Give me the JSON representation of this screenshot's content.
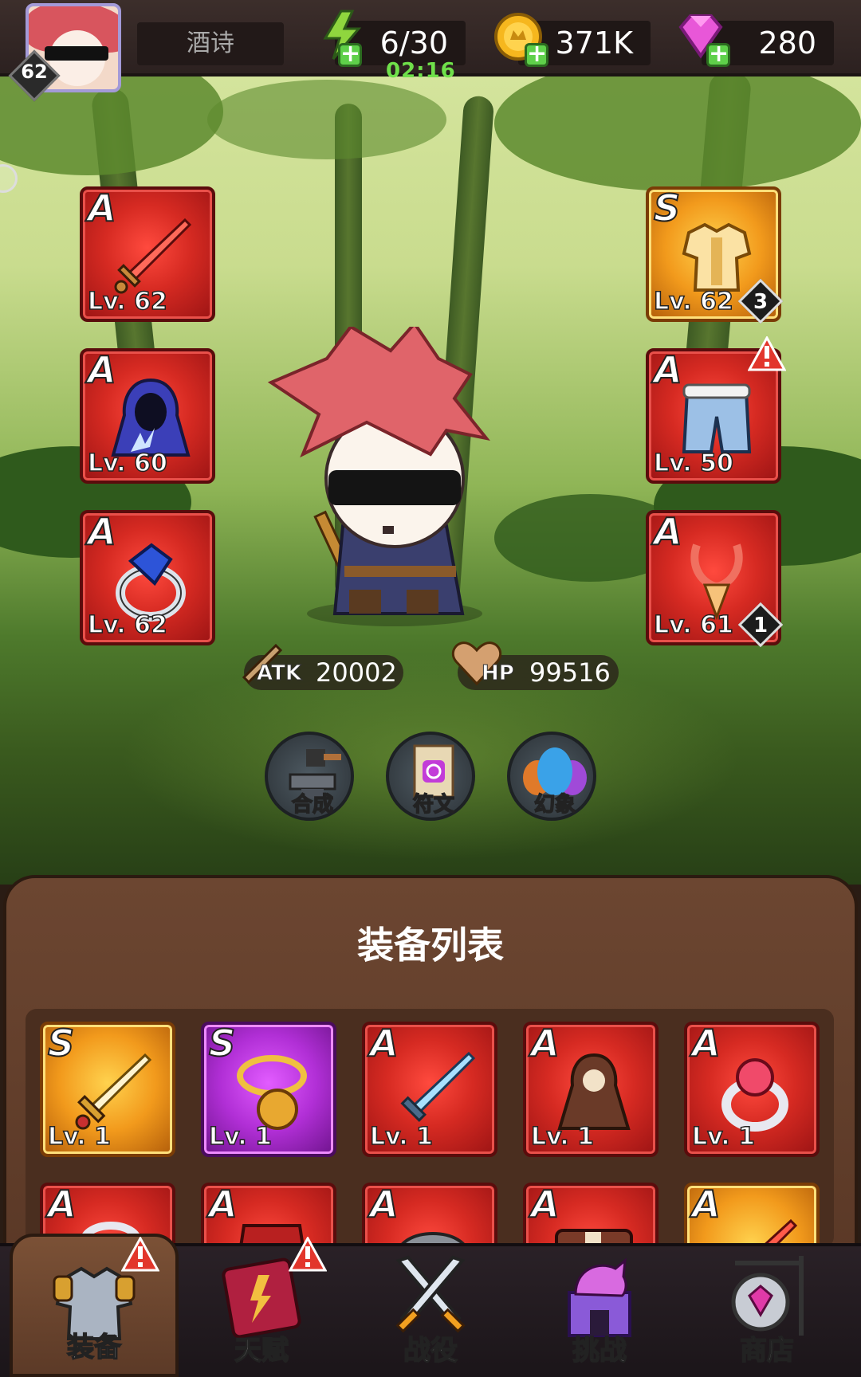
{
  "topbar": {
    "player_level": "62",
    "player_name": "酒诗",
    "energy": "6/30",
    "energy_timer": "02:16",
    "gold": "371K",
    "gems": "280"
  },
  "equipped_left": [
    {
      "grade": "A",
      "level": "Lv. 62",
      "item": "sword-icon"
    },
    {
      "grade": "A",
      "level": "Lv. 60",
      "item": "cloak-icon"
    },
    {
      "grade": "A",
      "level": "Lv. 62",
      "item": "ring-icon"
    }
  ],
  "equipped_right": [
    {
      "grade": "S",
      "level": "Lv. 62",
      "item": "armor-icon",
      "stars": "3"
    },
    {
      "grade": "A",
      "level": "Lv. 50",
      "item": "pants-icon",
      "alert": true
    },
    {
      "grade": "A",
      "level": "Lv. 61",
      "item": "necklace-icon",
      "stars": "1"
    }
  ],
  "stats": {
    "atk_label": "ATK",
    "atk": "20002",
    "hp_label": "HP",
    "hp": "99516"
  },
  "actions": [
    {
      "label": "合成",
      "icon": "anvil-icon"
    },
    {
      "label": "符文",
      "icon": "rune-scroll-icon"
    },
    {
      "label": "幻象",
      "icon": "illusion-icon"
    }
  ],
  "panel": {
    "title": "装备列表",
    "row1": [
      {
        "grade": "S",
        "level": "Lv. 1",
        "item": "golden-sword-icon",
        "bg": "gold"
      },
      {
        "grade": "S",
        "level": "Lv. 1",
        "item": "lion-necklace-icon",
        "bg": "purple"
      },
      {
        "grade": "A",
        "level": "Lv. 1",
        "item": "ice-sword-icon",
        "bg": "red"
      },
      {
        "grade": "A",
        "level": "Lv. 1",
        "item": "skull-cloak-icon",
        "bg": "red"
      },
      {
        "grade": "A",
        "level": "Lv. 1",
        "item": "ruby-ring-icon",
        "bg": "red"
      }
    ],
    "row2": [
      {
        "grade": "A",
        "item": "ring-icon",
        "bg": "red"
      },
      {
        "grade": "A",
        "item": "red-armor-icon",
        "bg": "red"
      },
      {
        "grade": "A",
        "item": "helmet-icon",
        "bg": "red"
      },
      {
        "grade": "A",
        "item": "belt-icon",
        "bg": "red"
      },
      {
        "grade": "A",
        "item": "sword-icon",
        "bg": "gold"
      }
    ]
  },
  "nav": [
    {
      "label": "装备",
      "icon": "armor-icon",
      "active": true,
      "alert": true
    },
    {
      "label": "天赋",
      "icon": "talent-book-icon",
      "active": false,
      "alert": true
    },
    {
      "label": "战役",
      "icon": "crossed-swords-icon",
      "active": false,
      "alert": false
    },
    {
      "label": "挑战",
      "icon": "dragon-castle-icon",
      "active": false,
      "alert": false
    },
    {
      "label": "商店",
      "icon": "shop-sign-icon",
      "active": false,
      "alert": false
    }
  ]
}
